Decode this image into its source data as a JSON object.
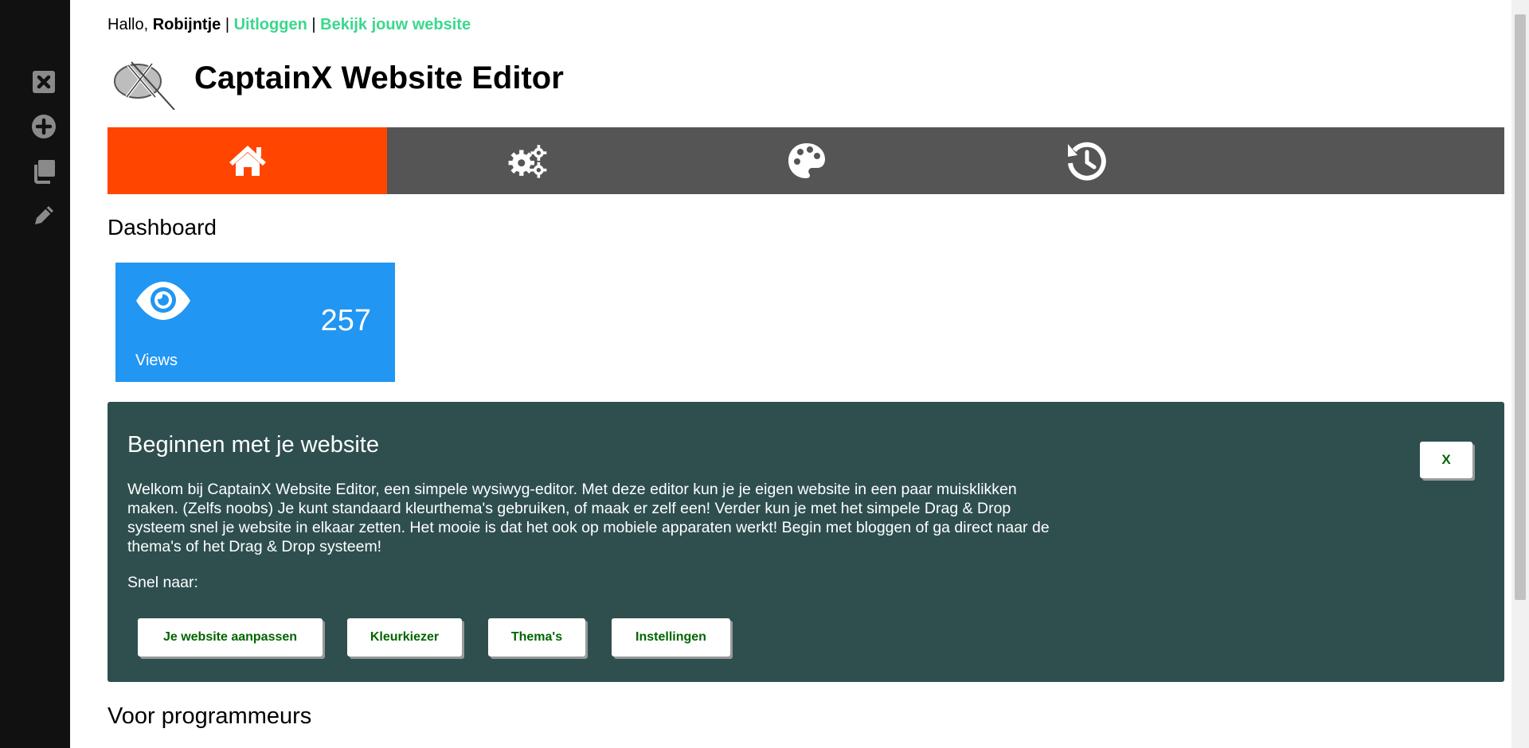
{
  "sidebar": {
    "items": [
      {
        "icon": "close-box-icon"
      },
      {
        "icon": "plus-circle-icon"
      },
      {
        "icon": "copy-icon"
      },
      {
        "icon": "pencil-icon"
      }
    ],
    "icon_color": "#888888"
  },
  "header": {
    "greeting_prefix": "Hallo,",
    "username": "Robijntje",
    "separator": "|",
    "logout_link": "Uitloggen",
    "view_site_link": "Bekijk jouw website",
    "app_title": "CaptainX Website Editor"
  },
  "nav": {
    "tabs": [
      {
        "icon": "home-icon",
        "active": true
      },
      {
        "icon": "gears-icon",
        "active": false
      },
      {
        "icon": "palette-icon",
        "active": false
      },
      {
        "icon": "history-icon",
        "active": false
      }
    ],
    "active_color": "#ff4500",
    "bar_color": "#555555"
  },
  "dashboard": {
    "title": "Dashboard",
    "views_card": {
      "icon": "eye-icon",
      "count": "257",
      "label": "Views",
      "color": "#2196f3"
    }
  },
  "intro_panel": {
    "title": "Beginnen met je website",
    "close_label": "X",
    "body": "Welkom bij CaptainX Website Editor, een simpele wysiwyg-editor. Met deze editor kun je je eigen website in een paar muisklikken maken. (Zelfs noobs) Je kunt standaard kleurthema's gebruiken, of maak er zelf een! Verder kun je met het simpele Drag & Drop systeem snel je website in elkaar zetten. Het mooie is dat het ook op mobiele apparaten werkt! Begin met bloggen of ga direct naar de thema's of het Drag & Drop systeem!",
    "quick_label": "Snel naar:",
    "quick_buttons": [
      "Je website aanpassen",
      "Kleurkiezer",
      "Thema's",
      "Instellingen"
    ],
    "color": "#2f4f4f"
  },
  "programmers": {
    "title": "Voor programmeurs"
  }
}
